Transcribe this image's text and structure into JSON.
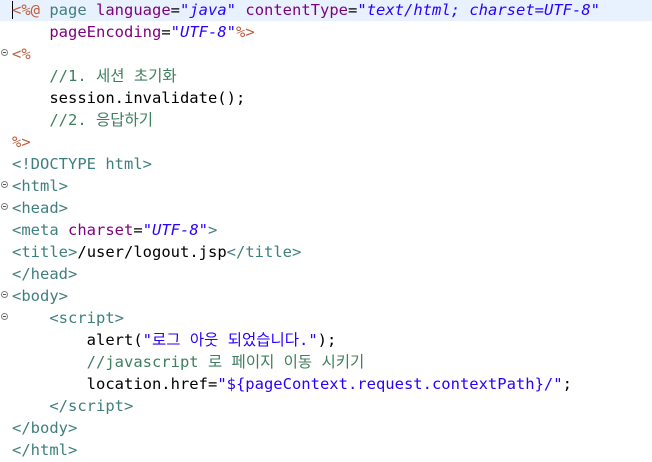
{
  "editor": {
    "file": "/user/logout.jsp",
    "lines": [
      {
        "fold": false,
        "current": true,
        "tokens": [
          {
            "t": "delim",
            "v": "<%@"
          },
          {
            "t": "text",
            "v": " "
          },
          {
            "t": "kw",
            "v": "page"
          },
          {
            "t": "text",
            "v": " "
          },
          {
            "t": "attr",
            "v": "language"
          },
          {
            "t": "text",
            "v": "="
          },
          {
            "t": "str",
            "v": "\"java\""
          },
          {
            "t": "text",
            "v": " "
          },
          {
            "t": "attr",
            "v": "contentType"
          },
          {
            "t": "text",
            "v": "="
          },
          {
            "t": "str",
            "v": "\"text/html; charset=UTF-8\""
          }
        ]
      },
      {
        "fold": false,
        "current": false,
        "tokens": [
          {
            "t": "text",
            "v": "    "
          },
          {
            "t": "attr",
            "v": "pageEncoding"
          },
          {
            "t": "text",
            "v": "="
          },
          {
            "t": "str",
            "v": "\"UTF-8\""
          },
          {
            "t": "delim",
            "v": "%>"
          }
        ]
      },
      {
        "fold": true,
        "current": false,
        "tokens": [
          {
            "t": "delim",
            "v": "<%"
          }
        ]
      },
      {
        "fold": false,
        "current": false,
        "tokens": [
          {
            "t": "text",
            "v": "    "
          },
          {
            "t": "comment",
            "v": "//1. 세션 초기화"
          }
        ]
      },
      {
        "fold": false,
        "current": false,
        "tokens": [
          {
            "t": "text",
            "v": "    session.invalidate();"
          }
        ]
      },
      {
        "fold": false,
        "current": false,
        "tokens": [
          {
            "t": "text",
            "v": "    "
          },
          {
            "t": "comment",
            "v": "//2. 응답하기"
          }
        ]
      },
      {
        "fold": false,
        "current": false,
        "tokens": [
          {
            "t": "delim",
            "v": "%>"
          }
        ]
      },
      {
        "fold": false,
        "current": false,
        "tokens": [
          {
            "t": "tag",
            "v": "<!DOCTYPE"
          },
          {
            "t": "text",
            "v": " "
          },
          {
            "t": "tagname",
            "v": "html"
          },
          {
            "t": "tag",
            "v": ">"
          }
        ]
      },
      {
        "fold": true,
        "current": false,
        "tokens": [
          {
            "t": "tag",
            "v": "<"
          },
          {
            "t": "tagname",
            "v": "html"
          },
          {
            "t": "tag",
            "v": ">"
          }
        ]
      },
      {
        "fold": true,
        "current": false,
        "tokens": [
          {
            "t": "tag",
            "v": "<"
          },
          {
            "t": "tagname",
            "v": "head"
          },
          {
            "t": "tag",
            "v": ">"
          }
        ]
      },
      {
        "fold": false,
        "current": false,
        "tokens": [
          {
            "t": "tag",
            "v": "<"
          },
          {
            "t": "tagname",
            "v": "meta"
          },
          {
            "t": "text",
            "v": " "
          },
          {
            "t": "attr",
            "v": "charset"
          },
          {
            "t": "text",
            "v": "="
          },
          {
            "t": "str",
            "v": "\"UTF-8\""
          },
          {
            "t": "tag",
            "v": ">"
          }
        ]
      },
      {
        "fold": false,
        "current": false,
        "tokens": [
          {
            "t": "tag",
            "v": "<"
          },
          {
            "t": "tagname",
            "v": "title"
          },
          {
            "t": "tag",
            "v": ">"
          },
          {
            "t": "text",
            "v": "/user/logout.jsp"
          },
          {
            "t": "tag",
            "v": "</"
          },
          {
            "t": "tagname",
            "v": "title"
          },
          {
            "t": "tag",
            "v": ">"
          }
        ]
      },
      {
        "fold": false,
        "current": false,
        "tokens": [
          {
            "t": "tag",
            "v": "</"
          },
          {
            "t": "tagname",
            "v": "head"
          },
          {
            "t": "tag",
            "v": ">"
          }
        ]
      },
      {
        "fold": true,
        "current": false,
        "tokens": [
          {
            "t": "tag",
            "v": "<"
          },
          {
            "t": "tagname",
            "v": "body"
          },
          {
            "t": "tag",
            "v": ">"
          }
        ]
      },
      {
        "fold": true,
        "current": false,
        "tokens": [
          {
            "t": "text",
            "v": "    "
          },
          {
            "t": "tag",
            "v": "<"
          },
          {
            "t": "tagname",
            "v": "script"
          },
          {
            "t": "tag",
            "v": ">"
          }
        ]
      },
      {
        "fold": false,
        "current": false,
        "tokens": [
          {
            "t": "text",
            "v": "        alert("
          },
          {
            "t": "jsstr",
            "v": "\"로그 아웃 되었습니다.\""
          },
          {
            "t": "text",
            "v": ");"
          }
        ]
      },
      {
        "fold": false,
        "current": false,
        "tokens": [
          {
            "t": "text",
            "v": "        "
          },
          {
            "t": "comment",
            "v": "//javascript 로 페이지 이동 시키기"
          }
        ]
      },
      {
        "fold": false,
        "current": false,
        "tokens": [
          {
            "t": "text",
            "v": "        location.href="
          },
          {
            "t": "jsstr",
            "v": "\"${pageContext.request.contextPath}/\""
          },
          {
            "t": "text",
            "v": ";"
          }
        ]
      },
      {
        "fold": false,
        "current": false,
        "tokens": [
          {
            "t": "text",
            "v": "    "
          },
          {
            "t": "tag",
            "v": "</"
          },
          {
            "t": "tagname",
            "v": "script"
          },
          {
            "t": "tag",
            "v": ">"
          }
        ]
      },
      {
        "fold": false,
        "current": false,
        "tokens": [
          {
            "t": "tag",
            "v": "</"
          },
          {
            "t": "tagname",
            "v": "body"
          },
          {
            "t": "tag",
            "v": ">"
          }
        ]
      },
      {
        "fold": false,
        "current": false,
        "tokens": [
          {
            "t": "tag",
            "v": "</"
          },
          {
            "t": "tagname",
            "v": "html"
          },
          {
            "t": "tag",
            "v": ">"
          }
        ]
      }
    ]
  }
}
